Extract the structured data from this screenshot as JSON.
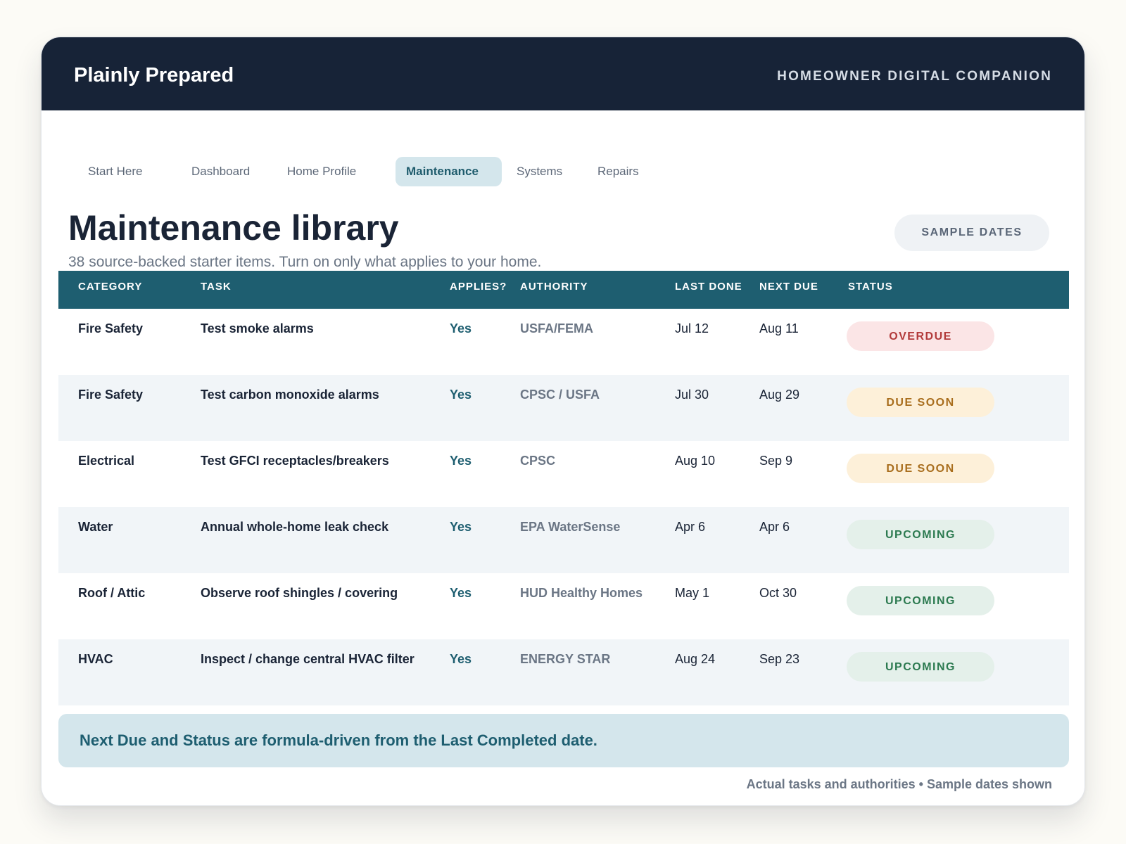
{
  "app": {
    "brand": "Plainly Prepared",
    "tagline": "HOMEOWNER DIGITAL COMPANION"
  },
  "nav": {
    "items": [
      {
        "label": "Start Here",
        "active": false
      },
      {
        "label": "Dashboard",
        "active": false
      },
      {
        "label": "Home Profile",
        "active": false
      },
      {
        "label": "Maintenance",
        "active": true
      },
      {
        "label": "Systems",
        "active": false
      },
      {
        "label": "Repairs",
        "active": false
      }
    ]
  },
  "page": {
    "title": "Maintenance library",
    "subtitle": "38 source-backed starter items. Turn on only what applies to your home.",
    "sample_dates_label": "SAMPLE DATES"
  },
  "table": {
    "columns": [
      "CATEGORY",
      "TASK",
      "APPLIES?",
      "AUTHORITY",
      "LAST DONE",
      "NEXT DUE",
      "STATUS"
    ],
    "rows": [
      {
        "category": "Fire Safety",
        "task": "Test smoke alarms",
        "applies": "Yes",
        "authority": "USFA/FEMA",
        "last_done": "Jul 12",
        "next_due": "Aug 11",
        "status": "OVERDUE",
        "status_kind": "overdue"
      },
      {
        "category": "Fire Safety",
        "task": "Test carbon monoxide alarms",
        "applies": "Yes",
        "authority": "CPSC / USFA",
        "last_done": "Jul 30",
        "next_due": "Aug 29",
        "status": "DUE SOON",
        "status_kind": "soon"
      },
      {
        "category": "Electrical",
        "task": "Test GFCI receptacles/breakers",
        "applies": "Yes",
        "authority": "CPSC",
        "last_done": "Aug 10",
        "next_due": "Sep 9",
        "status": "DUE SOON",
        "status_kind": "soon"
      },
      {
        "category": "Water",
        "task": "Annual whole-home leak check",
        "applies": "Yes",
        "authority": "EPA WaterSense",
        "last_done": "Apr 6",
        "next_due": "Apr 6",
        "status": "UPCOMING",
        "status_kind": "upcoming"
      },
      {
        "category": "Roof / Attic",
        "task": "Observe roof shingles / covering",
        "applies": "Yes",
        "authority": "HUD Healthy Homes",
        "last_done": "May 1",
        "next_due": "Oct 30",
        "status": "UPCOMING",
        "status_kind": "upcoming"
      },
      {
        "category": "HVAC",
        "task": "Inspect / change central HVAC filter",
        "applies": "Yes",
        "authority": "ENERGY STAR",
        "last_done": "Aug 24",
        "next_due": "Sep 23",
        "status": "UPCOMING",
        "status_kind": "upcoming"
      }
    ]
  },
  "note": "Next Due and Status are formula-driven from the Last Completed date.",
  "footer": "Actual tasks and authorities • Sample dates shown",
  "colors": {
    "header_bg": "#172337",
    "table_header_bg": "#1e5e70",
    "accent": "#1e5e70",
    "overdue": "#b23a3a",
    "due_soon": "#a86d1c",
    "upcoming": "#2c7a50"
  }
}
